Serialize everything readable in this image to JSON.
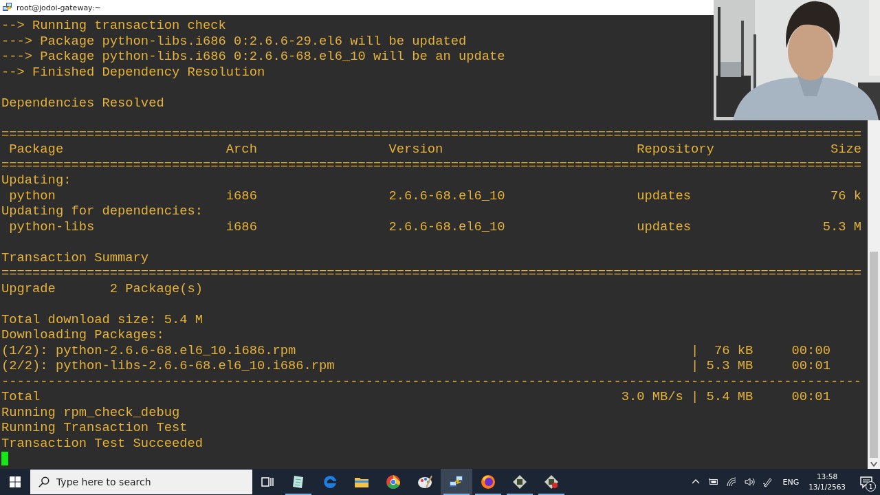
{
  "window": {
    "title": "root@jodoi-gateway:~"
  },
  "terminal": {
    "lines": [
      {
        "kind": "text",
        "text": "--> Running transaction check"
      },
      {
        "kind": "text",
        "text": "---> Package python-libs.i686 0:2.6.6-29.el6 will be updated"
      },
      {
        "kind": "text",
        "text": "---> Package python-libs.i686 0:2.6.6-68.el6_10 will be an update"
      },
      {
        "kind": "text",
        "text": "--> Finished Dependency Resolution"
      },
      {
        "kind": "blank"
      },
      {
        "kind": "text",
        "text": "Dependencies Resolved"
      },
      {
        "kind": "blank"
      },
      {
        "kind": "rule",
        "text": "==============================================================================================================="
      },
      {
        "kind": "header",
        "cells": [
          "Package",
          "Arch",
          "Version",
          "Repository",
          "Size"
        ]
      },
      {
        "kind": "rule",
        "text": "==============================================================================================================="
      },
      {
        "kind": "text",
        "text": "Updating:"
      },
      {
        "kind": "package",
        "cells": [
          "python",
          "i686",
          "2.6.6-68.el6_10",
          "updates",
          "76 k"
        ]
      },
      {
        "kind": "text",
        "text": "Updating for dependencies:"
      },
      {
        "kind": "package",
        "cells": [
          "python-libs",
          "i686",
          "2.6.6-68.el6_10",
          "updates",
          "5.3 M"
        ]
      },
      {
        "kind": "blank"
      },
      {
        "kind": "text",
        "text": "Transaction Summary"
      },
      {
        "kind": "rule",
        "text": "==============================================================================================================="
      },
      {
        "kind": "summary",
        "cells": [
          "Upgrade",
          "2 Package(s)"
        ]
      },
      {
        "kind": "blank"
      },
      {
        "kind": "text",
        "text": "Total download size: 5.4 M"
      },
      {
        "kind": "text",
        "text": "Downloading Packages:"
      },
      {
        "kind": "download",
        "cells": [
          "(1/2): python-2.6.6-68.el6_10.i686.rpm",
          "|",
          "76 kB",
          "00:00"
        ]
      },
      {
        "kind": "download",
        "cells": [
          "(2/2): python-libs-2.6.6-68.el6_10.i686.rpm",
          "|",
          "5.3 MB",
          "00:01"
        ]
      },
      {
        "kind": "rule",
        "text": "---------------------------------------------------------------------------------------------------------------"
      },
      {
        "kind": "total",
        "cells": [
          "Total",
          "3.0 MB/s",
          "|",
          "5.4 MB",
          "00:01"
        ]
      },
      {
        "kind": "text",
        "text": "Running rpm_check_debug"
      },
      {
        "kind": "text",
        "text": "Running Transaction Test"
      },
      {
        "kind": "text",
        "text": "Transaction Test Succeeded"
      },
      {
        "kind": "cursor"
      }
    ]
  },
  "taskbar": {
    "search": {
      "placeholder": "Type here to search"
    },
    "apps": [
      {
        "running": true,
        "selected": false
      },
      {
        "running": false,
        "selected": false
      },
      {
        "running": false,
        "selected": false
      },
      {
        "running": false,
        "selected": false
      },
      {
        "running": false,
        "selected": false
      },
      {
        "running": true,
        "selected": true
      },
      {
        "running": true,
        "selected": false
      },
      {
        "running": true,
        "selected": false
      },
      {
        "running": true,
        "selected": false
      }
    ],
    "language": "ENG",
    "time": "13:58",
    "date": "13/1/2563",
    "notifications": "1"
  }
}
